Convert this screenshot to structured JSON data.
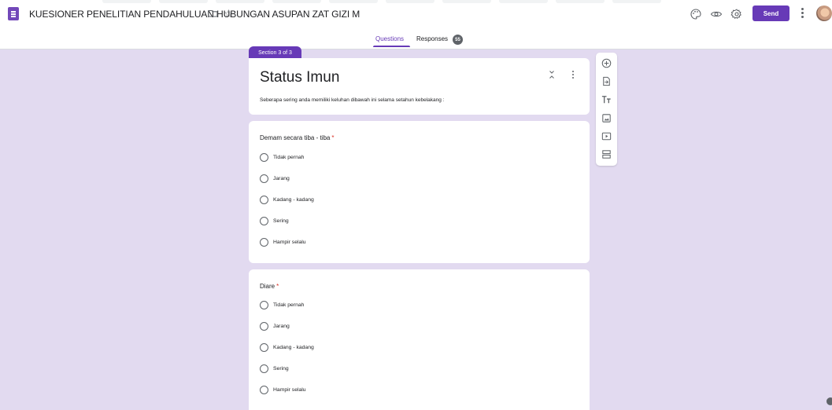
{
  "app": {
    "doc_title": "KUESIONER PENELITIAN PENDAHULUAN HUBUNGAN ASUPAN ZAT GIZI M",
    "send_label": "Send",
    "accent_color": "#673ab7",
    "background_color": "#e2daf0"
  },
  "tabs": {
    "questions": "Questions",
    "responses": "Responses",
    "responses_count": "55"
  },
  "section": {
    "tag": "Section 3 of 3",
    "title": "Status Imun",
    "description": "Seberapa sering anda memiliki keluhan dibawah ini selama setahun kebelakang :"
  },
  "questions": [
    {
      "title": "Demam secara tiba - tiba",
      "required_mark": "*",
      "options": [
        "Tidak pernah",
        "Jarang",
        "Kadang - kadang",
        "Sering",
        "Hampir selalu"
      ]
    },
    {
      "title": "Diare",
      "required_mark": "*",
      "options": [
        "Tidak pernah",
        "Jarang",
        "Kadang - kadang",
        "Sering",
        "Hampir selalu"
      ]
    }
  ],
  "icons": {
    "header": [
      "palette-icon",
      "preview-eye-icon",
      "settings-gear-icon",
      "more-vert-icon"
    ],
    "toolbar": [
      "add-question-icon",
      "import-questions-icon",
      "add-title-icon",
      "add-image-icon",
      "add-video-icon",
      "add-section-icon"
    ]
  }
}
